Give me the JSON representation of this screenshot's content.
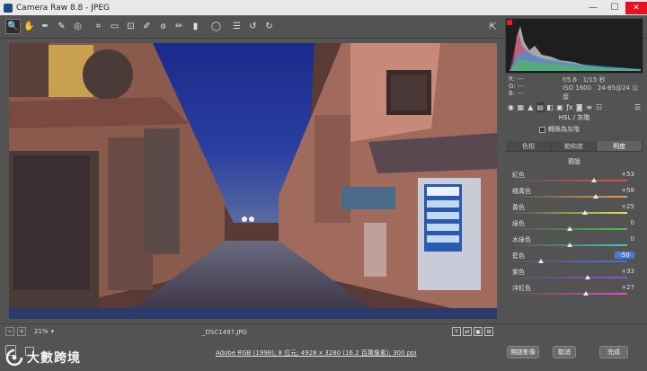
{
  "window": {
    "title": "Camera Raw 8.8 - JPEG",
    "minimize_glyph": "—",
    "maximize_glyph": "☐",
    "close_glyph": "✕"
  },
  "toolbar": {
    "tools": [
      {
        "name": "zoom-tool-icon",
        "glyph": "🔍"
      },
      {
        "name": "hand-tool-icon",
        "glyph": "✋"
      },
      {
        "name": "white-balance-tool-icon",
        "glyph": "✒"
      },
      {
        "name": "color-sampler-tool-icon",
        "glyph": "✎"
      },
      {
        "name": "targeted-adjustment-tool-icon",
        "glyph": "◎"
      },
      {
        "name": "crop-tool-icon",
        "glyph": "⌗"
      },
      {
        "name": "straighten-tool-icon",
        "glyph": "▭"
      },
      {
        "name": "transform-tool-icon",
        "glyph": "⊡"
      },
      {
        "name": "spot-removal-tool-icon",
        "glyph": "✐"
      },
      {
        "name": "red-eye-tool-icon",
        "glyph": "ꙩ"
      },
      {
        "name": "adjustment-brush-icon",
        "glyph": "✏"
      },
      {
        "name": "graduated-filter-icon",
        "glyph": "▮"
      },
      {
        "name": "radial-filter-icon",
        "glyph": "◯"
      },
      {
        "name": "preferences-icon",
        "glyph": "☰"
      },
      {
        "name": "rotate-left-icon",
        "glyph": "↺"
      },
      {
        "name": "rotate-right-icon",
        "glyph": "↻"
      }
    ],
    "fullscreen_glyph": "⇱"
  },
  "camera_info": {
    "r_label": "R:",
    "g_label": "G:",
    "b_label": "B:",
    "r_value": "---",
    "g_value": "---",
    "b_value": "---",
    "aperture": "f/5.6",
    "shutter": "1/15 秒",
    "iso": "ISO 1600",
    "lens": "24-85@24 公厘"
  },
  "panel": {
    "header": "HSL / 灰階",
    "grayscale_label": "轉換為灰階",
    "subtabs": [
      "色相",
      "飽和度",
      "明度"
    ],
    "active_subtab": 2,
    "section_title": "預設",
    "sliders": [
      {
        "label": "紅色",
        "value": "+53",
        "pos": 0.71,
        "gradient": "linear-gradient(to right, #555, #e05050)"
      },
      {
        "label": "橘黃色",
        "value": "+58",
        "pos": 0.73,
        "gradient": "linear-gradient(to right, #555, #e0a050)"
      },
      {
        "label": "黃色",
        "value": "+25",
        "pos": 0.63,
        "gradient": "linear-gradient(to right, #555, #e0e050)"
      },
      {
        "label": "綠色",
        "value": "0",
        "pos": 0.5,
        "gradient": "linear-gradient(to right, #555, #50c050)"
      },
      {
        "label": "水綠色",
        "value": "0",
        "pos": 0.5,
        "gradient": "linear-gradient(to right, #555, #50c0c0)"
      },
      {
        "label": "藍色",
        "value": "-50",
        "pos": 0.25,
        "gradient": "linear-gradient(to right, #555, #5070e0)",
        "selected": true
      },
      {
        "label": "紫色",
        "value": "+33",
        "pos": 0.66,
        "gradient": "linear-gradient(to right, #555, #9050e0)"
      },
      {
        "label": "洋紅色",
        "value": "+27",
        "pos": 0.64,
        "gradient": "linear-gradient(to right, #555, #e050c0)"
      }
    ]
  },
  "status": {
    "zoom": "21%",
    "filename": "_DSC1497.JPG",
    "view_buttons": [
      "Y",
      "⇄",
      "▣",
      "⊞"
    ]
  },
  "bottom": {
    "workflow_link": "Adobe RGB (1998); 8 位元; 4928 x 3280 (16.2 百萬像素); 300 ppi",
    "open_button": "開啟影像",
    "cancel_button": "取消",
    "done_button": "完成"
  },
  "watermark": {
    "text": "大數跨境"
  },
  "colors": {
    "accent_selected": "#4a7bd0",
    "panel_bg": "#535353",
    "close_red": "#e81123"
  }
}
